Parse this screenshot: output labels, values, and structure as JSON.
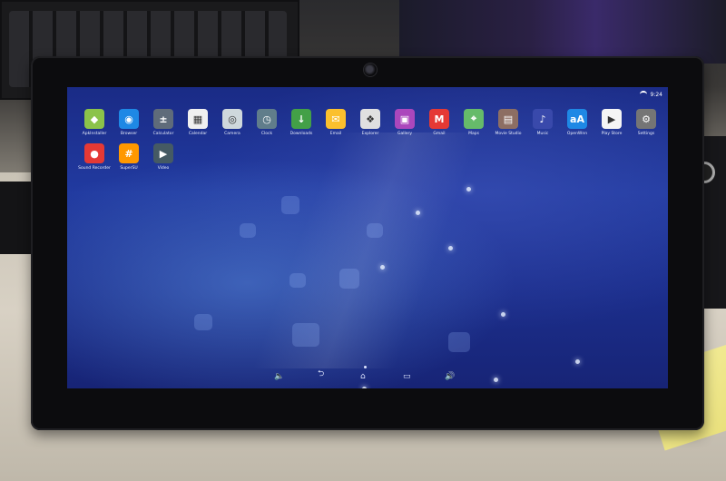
{
  "status": {
    "time": "9:24"
  },
  "apps_row1": [
    {
      "label": "ApkInstaller",
      "icon": "android-icon",
      "color": "#8bc34a",
      "glyph": "◆"
    },
    {
      "label": "Browser",
      "icon": "globe-icon",
      "color": "#1e88e5",
      "glyph": "◉"
    },
    {
      "label": "Calculator",
      "icon": "calculator-icon",
      "color": "#5f6b7a",
      "glyph": "±"
    },
    {
      "label": "Calendar",
      "icon": "calendar-icon",
      "color": "#f0f0f0",
      "glyph": "▦"
    },
    {
      "label": "Camera",
      "icon": "camera-icon",
      "color": "#cfd8dc",
      "glyph": "◎"
    },
    {
      "label": "Clock",
      "icon": "clock-icon",
      "color": "#607d8b",
      "glyph": "◷"
    },
    {
      "label": "Downloads",
      "icon": "download-icon",
      "color": "#43a047",
      "glyph": "↓"
    },
    {
      "label": "Email",
      "icon": "email-icon",
      "color": "#fbc02d",
      "glyph": "✉"
    },
    {
      "label": "Explorer",
      "icon": "file-explorer-icon",
      "color": "#e0e0e0",
      "glyph": "❖"
    },
    {
      "label": "Gallery",
      "icon": "gallery-icon",
      "color": "#ab47bc",
      "glyph": "▣"
    },
    {
      "label": "Gmail",
      "icon": "gmail-icon",
      "color": "#e53935",
      "glyph": "M"
    },
    {
      "label": "Maps",
      "icon": "maps-icon",
      "color": "#66bb6a",
      "glyph": "⌖"
    },
    {
      "label": "Movie Studio",
      "icon": "movie-studio-icon",
      "color": "#8d6e63",
      "glyph": "▤"
    },
    {
      "label": "Music",
      "icon": "music-icon",
      "color": "#3949ab",
      "glyph": "♪"
    },
    {
      "label": "OpenWnn",
      "icon": "keyboard-aa-icon",
      "color": "#1e88e5",
      "glyph": "aA"
    },
    {
      "label": "Play Store",
      "icon": "play-store-icon",
      "color": "#f5f5f5",
      "glyph": "▶"
    },
    {
      "label": "Settings",
      "icon": "gear-icon",
      "color": "#757575",
      "glyph": "⚙"
    }
  ],
  "apps_row2": [
    {
      "label": "Sound Recorder",
      "icon": "microphone-icon",
      "color": "#e53935",
      "glyph": "●"
    },
    {
      "label": "SuperSU",
      "icon": "supersu-icon",
      "color": "#ff9800",
      "glyph": "#"
    },
    {
      "label": "Video",
      "icon": "video-icon",
      "color": "#455a64",
      "glyph": "▶"
    }
  ],
  "nav": {
    "vol_down": "🔈",
    "back": "⮌",
    "home": "⌂",
    "recents": "▭",
    "vol_up": "🔊"
  }
}
